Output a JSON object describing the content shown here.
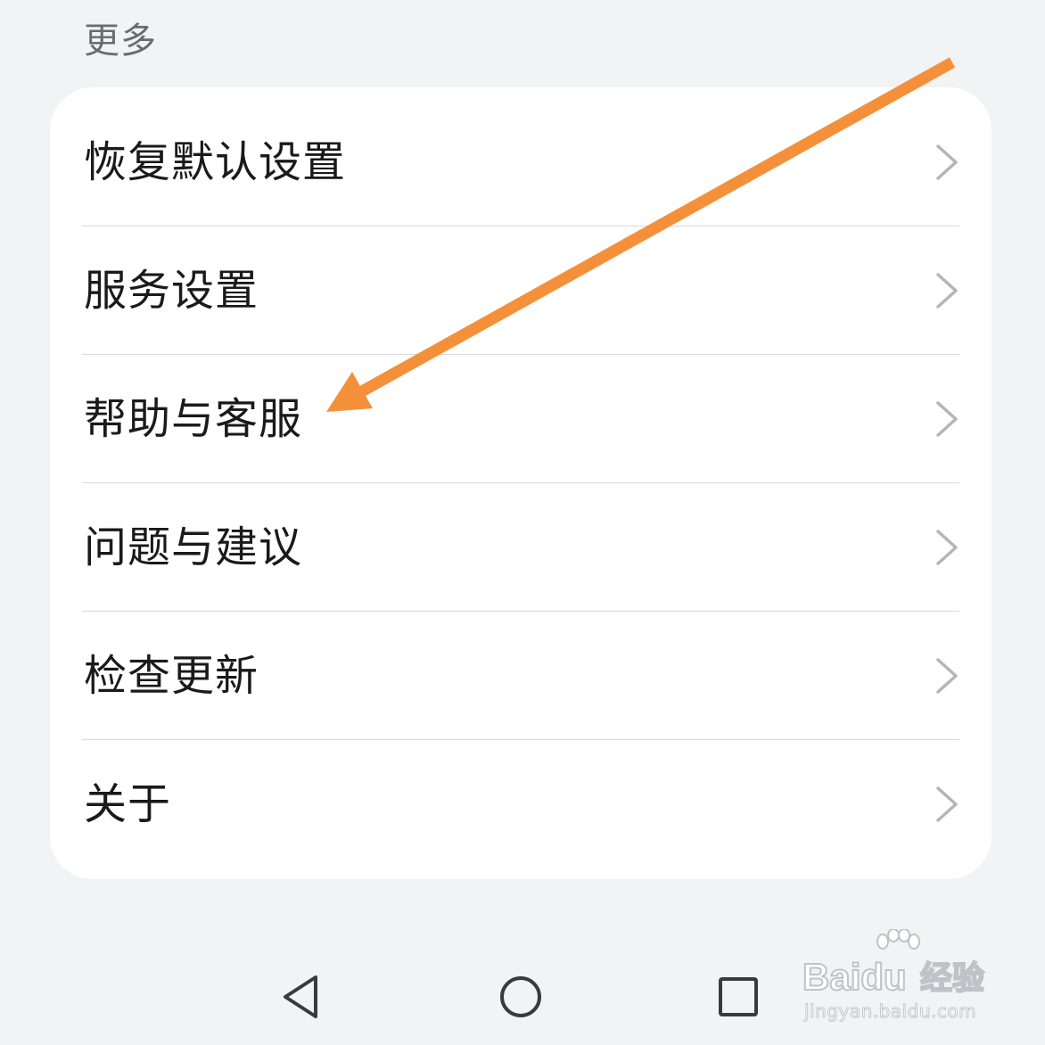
{
  "section": {
    "title": "更多"
  },
  "menu": {
    "items": [
      {
        "label": "恢复默认设置",
        "icon": "chevron-right-icon"
      },
      {
        "label": "服务设置",
        "icon": "chevron-right-icon"
      },
      {
        "label": "帮助与客服",
        "icon": "chevron-right-icon"
      },
      {
        "label": "问题与建议",
        "icon": "chevron-right-icon"
      },
      {
        "label": "检查更新",
        "icon": "chevron-right-icon"
      },
      {
        "label": "关于",
        "icon": "chevron-right-icon"
      }
    ]
  },
  "nav": {
    "back_icon": "triangle-back-icon",
    "home_icon": "circle-home-icon",
    "recents_icon": "square-recents-icon"
  },
  "annotation": {
    "arrow_color": "#f5903a",
    "target": "帮助与客服"
  },
  "watermark": {
    "brand": "Bai",
    "brand_du": "du",
    "suffix": "经验",
    "url": "jingyan.baidu.com"
  },
  "colors": {
    "background": "#f1f3f5",
    "card": "#ffffff",
    "text_primary": "#1a1a1a",
    "text_secondary": "#6b6b6b",
    "chevron": "#b5b5b5",
    "divider": "#d9d9d9"
  }
}
